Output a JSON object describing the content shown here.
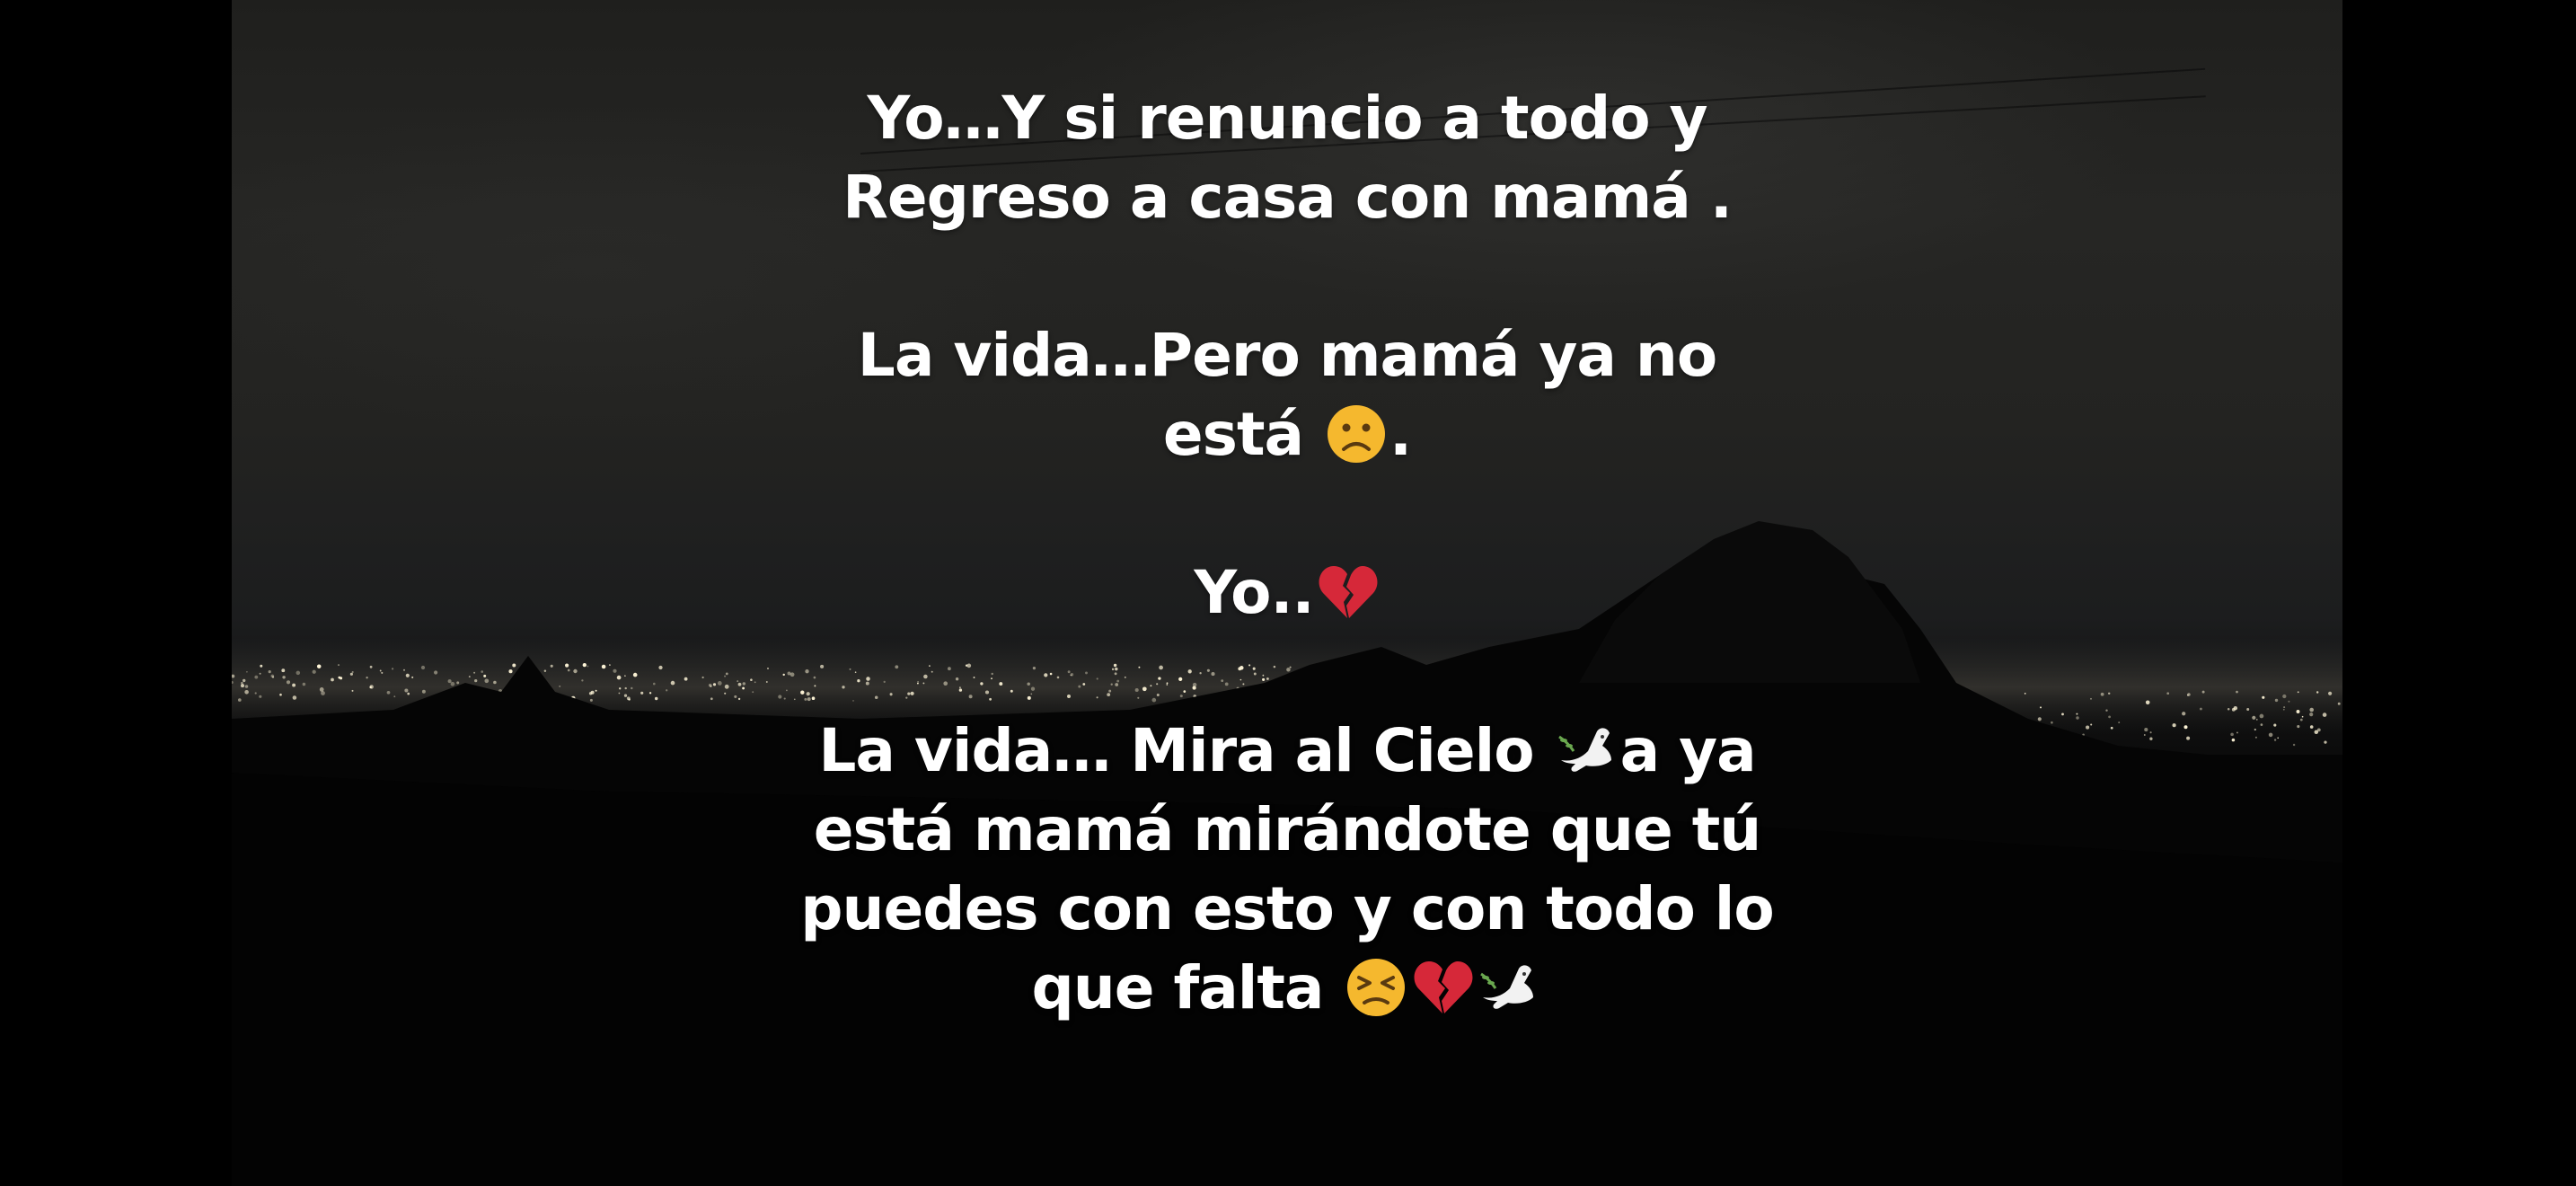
{
  "caption": {
    "stanza_1": {
      "line_1": "Yo…Y si renuncio a todo y",
      "line_2": "Regreso a casa con mamá ."
    },
    "stanza_2": {
      "line_1": "La vida…Pero mamá ya no",
      "line_2_text": "está",
      "line_2_end": "."
    },
    "stanza_3": {
      "line_1_text": "Yo.."
    },
    "stanza_4": {
      "line_1_start": "La vida… Mira al Cielo",
      "line_1_end": "a ya",
      "line_2": "está mamá mirándote que tú",
      "line_3": "puedes con esto y con todo lo",
      "line_4_text": "que falta"
    }
  },
  "icons": {
    "confused": "slightly-frowning-face-icon",
    "heart": "broken-heart-icon",
    "dove": "dove-of-peace-icon",
    "persevering": "persevering-face-icon"
  },
  "colors": {
    "text": "#ffffff",
    "letterbox": "#000000",
    "sky": "#262624",
    "emoji_face": "#f5b82e",
    "heart": "#d62839"
  }
}
